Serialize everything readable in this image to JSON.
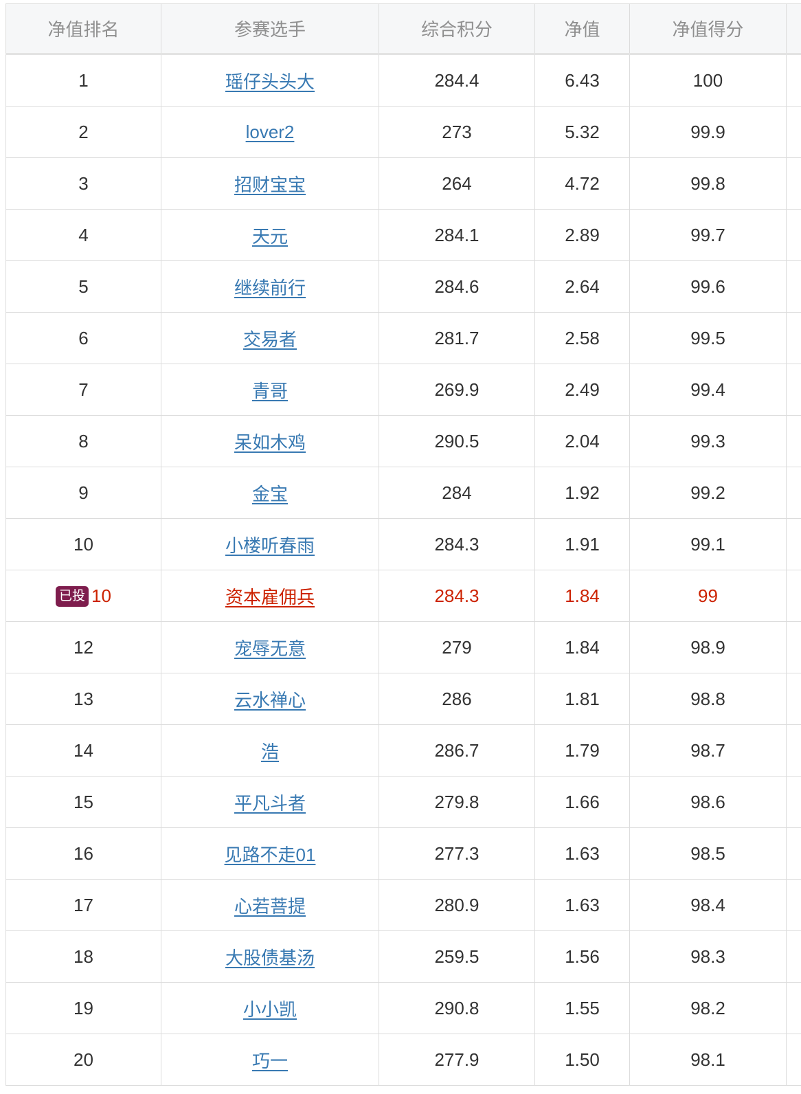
{
  "table": {
    "headers": [
      "净值排名",
      "参赛选手",
      "综合积分",
      "净值",
      "净值得分"
    ],
    "highlight_color": "#cc2200",
    "rows": [
      {
        "rank": "1",
        "player": "瑶仔头头大",
        "points": "284.4",
        "nav": "6.43",
        "score": "100"
      },
      {
        "rank": "2",
        "player": "lover2",
        "points": "273",
        "nav": "5.32",
        "score": "99.9"
      },
      {
        "rank": "3",
        "player": "招财宝宝",
        "points": "264",
        "nav": "4.72",
        "score": "99.8"
      },
      {
        "rank": "4",
        "player": "天元",
        "points": "284.1",
        "nav": "2.89",
        "score": "99.7"
      },
      {
        "rank": "5",
        "player": "继续前行",
        "points": "284.6",
        "nav": "2.64",
        "score": "99.6"
      },
      {
        "rank": "6",
        "player": "交易者",
        "points": "281.7",
        "nav": "2.58",
        "score": "99.5"
      },
      {
        "rank": "7",
        "player": "青哥",
        "points": "269.9",
        "nav": "2.49",
        "score": "99.4"
      },
      {
        "rank": "8",
        "player": "呆如木鸡",
        "points": "290.5",
        "nav": "2.04",
        "score": "99.3"
      },
      {
        "rank": "9",
        "player": "金宝",
        "points": "284",
        "nav": "1.92",
        "score": "99.2"
      },
      {
        "rank": "10",
        "player": "小楼听春雨",
        "points": "284.3",
        "nav": "1.91",
        "score": "99.1"
      },
      {
        "rank": "10",
        "badge": "已投",
        "highlight": true,
        "player": "资本雇佣兵",
        "points": "284.3",
        "nav": "1.84",
        "score": "99"
      },
      {
        "rank": "12",
        "player": "宠辱无意",
        "points": "279",
        "nav": "1.84",
        "score": "98.9"
      },
      {
        "rank": "13",
        "player": "云水禅心",
        "points": "286",
        "nav": "1.81",
        "score": "98.8"
      },
      {
        "rank": "14",
        "player": "浩",
        "points": "286.7",
        "nav": "1.79",
        "score": "98.7"
      },
      {
        "rank": "15",
        "player": "平凡斗者",
        "points": "279.8",
        "nav": "1.66",
        "score": "98.6"
      },
      {
        "rank": "16",
        "player": "见路不走01",
        "points": "277.3",
        "nav": "1.63",
        "score": "98.5"
      },
      {
        "rank": "17",
        "player": "心若菩提",
        "points": "280.9",
        "nav": "1.63",
        "score": "98.4"
      },
      {
        "rank": "18",
        "player": "大股债基汤",
        "points": "259.5",
        "nav": "1.56",
        "score": "98.3"
      },
      {
        "rank": "19",
        "player": "小小凯",
        "points": "290.8",
        "nav": "1.55",
        "score": "98.2"
      },
      {
        "rank": "20",
        "player": "巧一",
        "points": "277.9",
        "nav": "1.50",
        "score": "98.1"
      }
    ]
  }
}
